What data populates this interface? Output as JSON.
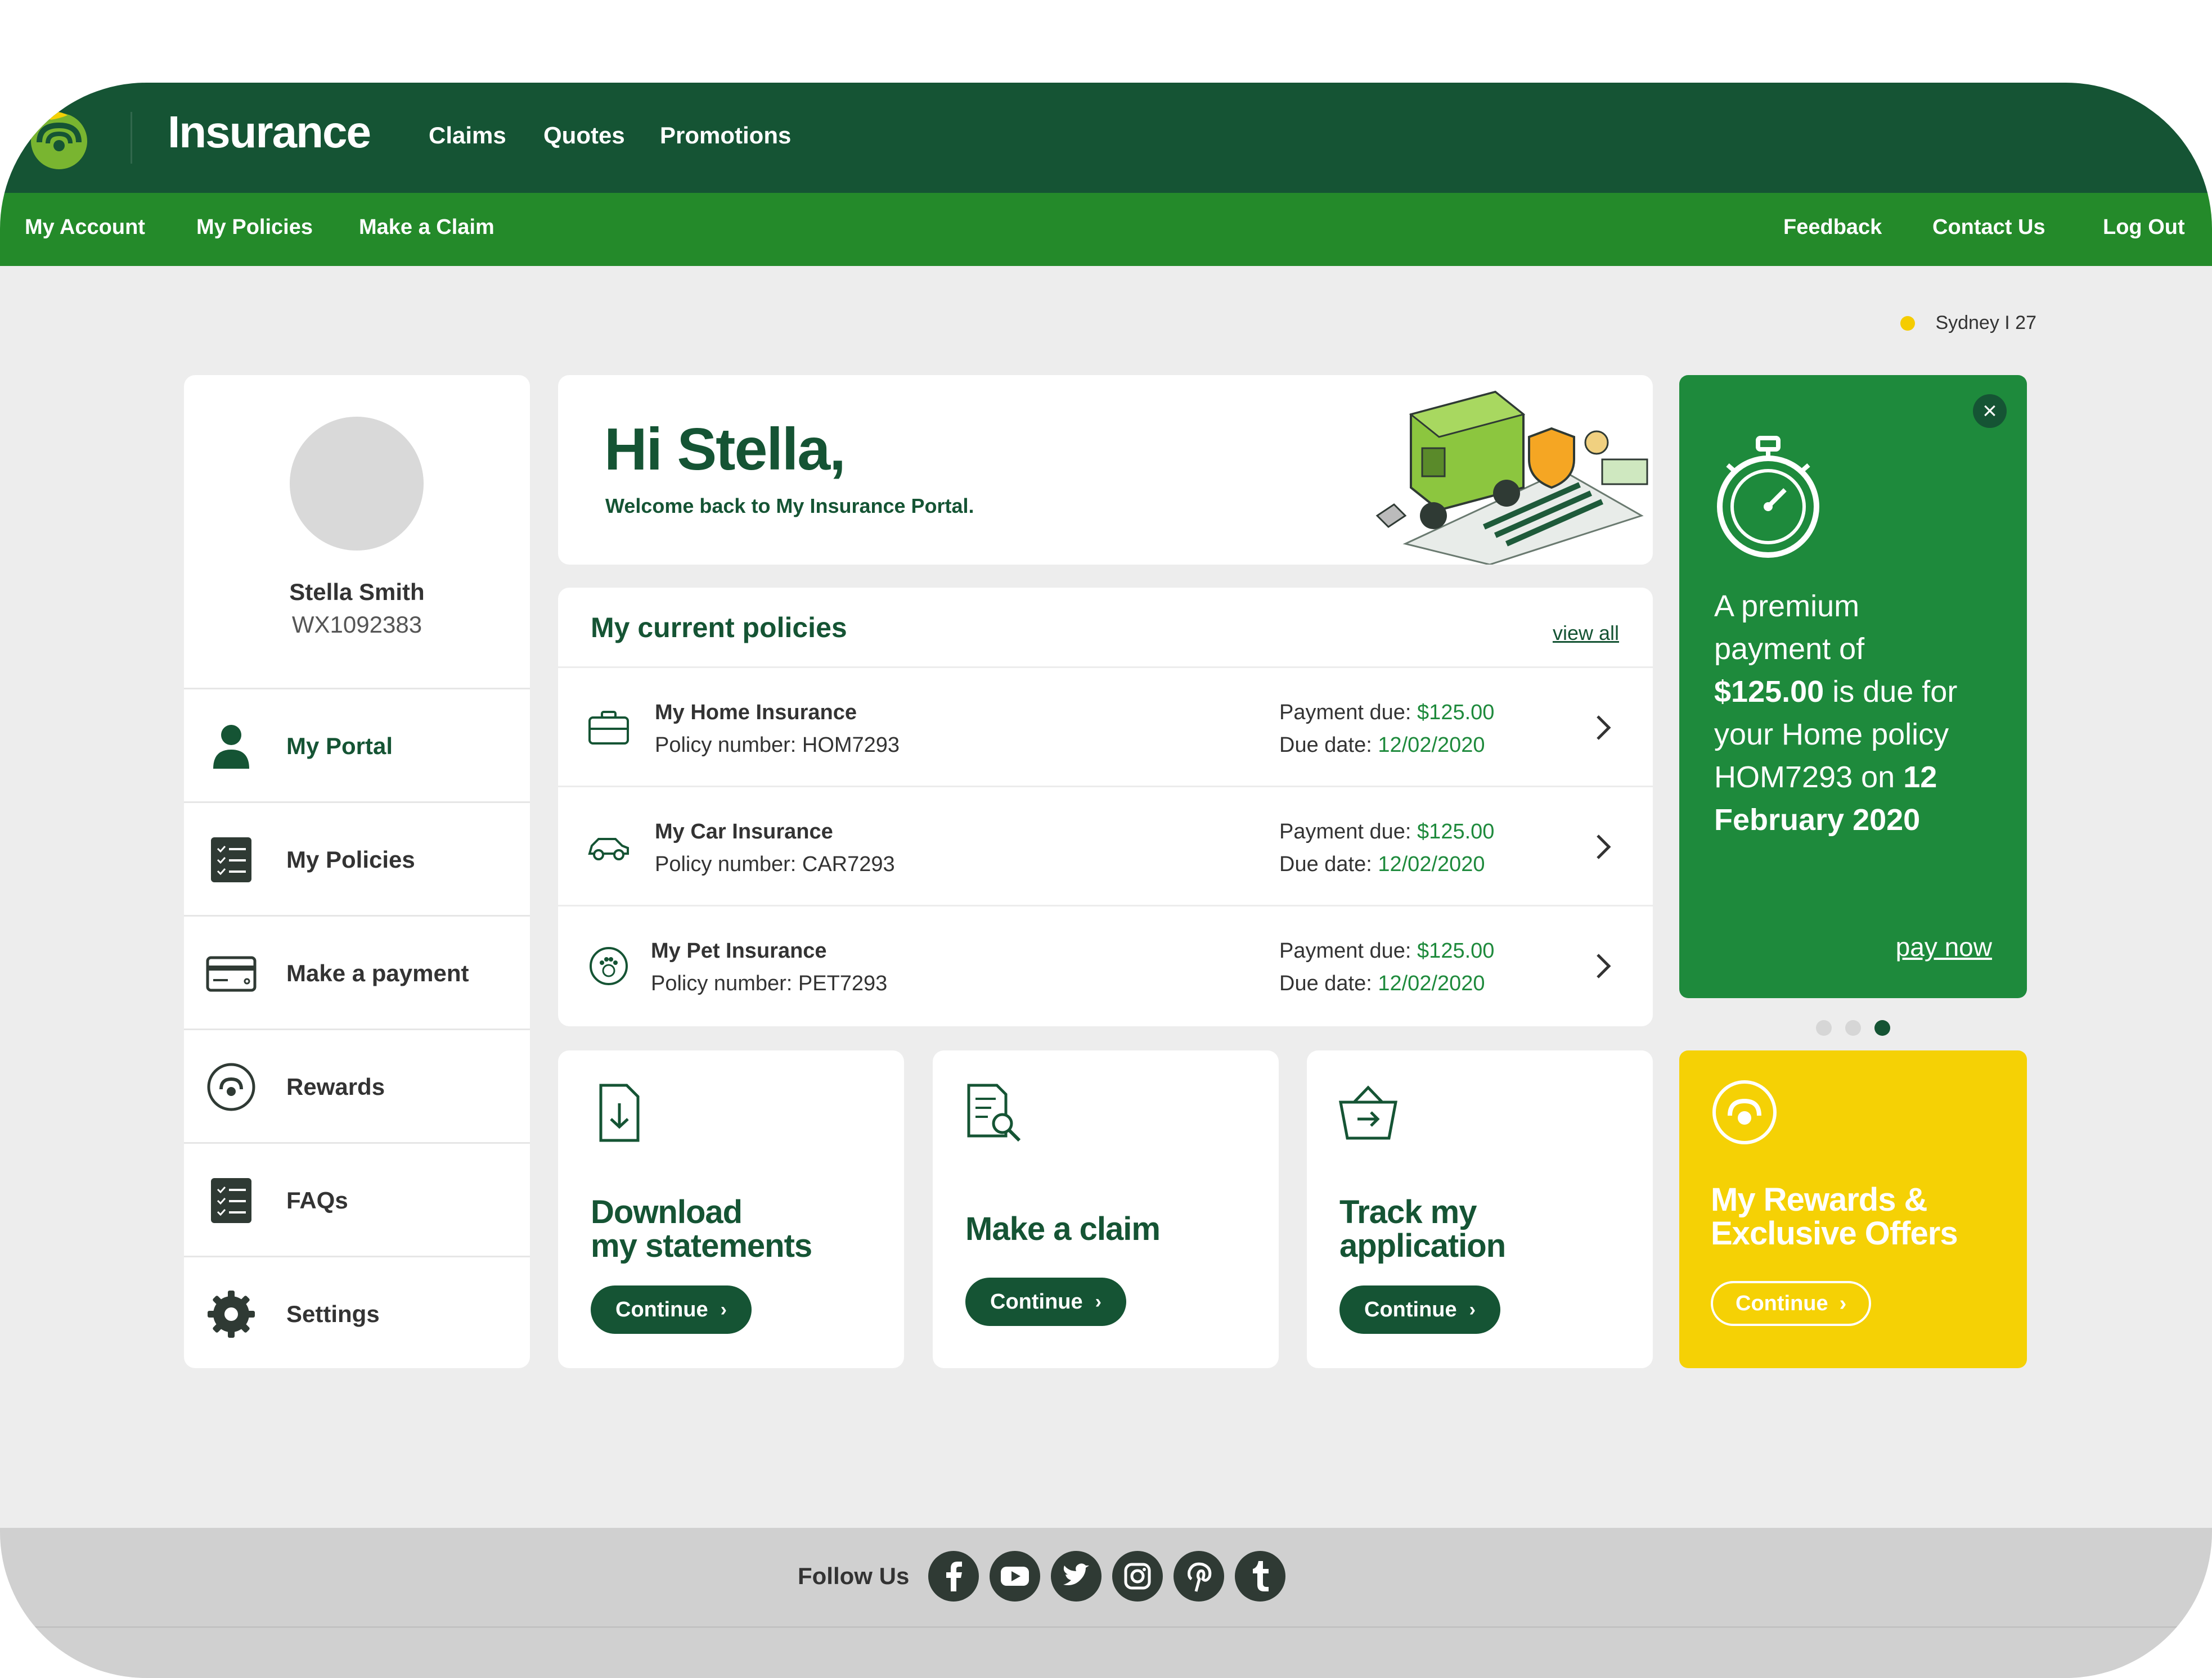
{
  "header": {
    "brand": "Insurance",
    "nav": [
      "Claims",
      "Quotes",
      "Promotions"
    ]
  },
  "subnav": {
    "left": [
      "My Account",
      "My Policies",
      "Make a Claim"
    ],
    "right": [
      "Feedback",
      "Contact Us",
      "Log Out"
    ]
  },
  "location": {
    "text": "Sydney I 27"
  },
  "profile": {
    "name": "Stella Smith",
    "id": "WX1092383"
  },
  "sidebar": {
    "items": [
      {
        "label": "My Portal",
        "icon": "person-icon",
        "active": true
      },
      {
        "label": "My Policies",
        "icon": "checklist-icon"
      },
      {
        "label": "Make a payment",
        "icon": "credit-card-icon"
      },
      {
        "label": "Rewards",
        "icon": "rewards-icon"
      },
      {
        "label": "FAQs",
        "icon": "checklist-icon"
      },
      {
        "label": "Settings",
        "icon": "gear-icon"
      }
    ]
  },
  "greeting": {
    "title": "Hi Stella,",
    "subtitle": "Welcome back to My Insurance Portal."
  },
  "policies": {
    "heading": "My current policies",
    "view_all": "view all",
    "payment_label": "Payment due:",
    "due_label": "Due date:",
    "items": [
      {
        "icon": "briefcase-icon",
        "name": "My Home Insurance",
        "number": "Policy number: HOM7293",
        "amount": "$125.00",
        "date": "12/02/2020"
      },
      {
        "icon": "car-icon",
        "name": "My Car Insurance",
        "number": "Policy number: CAR7293",
        "amount": "$125.00",
        "date": "12/02/2020"
      },
      {
        "icon": "paw-icon",
        "name": "My Pet Insurance",
        "number": "Policy number: PET7293",
        "amount": "$125.00",
        "date": "12/02/2020"
      }
    ]
  },
  "actions": [
    {
      "icon": "download-document-icon",
      "title1": "Download",
      "title2": "my statements",
      "button": "Continue"
    },
    {
      "icon": "search-document-icon",
      "title1": "Make a claim",
      "title2": "",
      "button": "Continue"
    },
    {
      "icon": "basket-icon",
      "title1": "Track my",
      "title2": "application",
      "button": "Continue"
    }
  ],
  "promo": {
    "line1": "A premium",
    "line2": "payment of",
    "amount": "$125.00",
    "line3": " is due for",
    "line4": "your Home policy",
    "line5": "HOM7293 on ",
    "date1": "12",
    "date2": "February 2020",
    "pay_now": "pay now",
    "carousel": {
      "count": 3,
      "active": 3
    }
  },
  "rewards": {
    "line1": "My Rewards &",
    "line2": "Exclusive Offers",
    "button": "Continue"
  },
  "footer": {
    "follow": "Follow Us",
    "social": [
      "facebook-icon",
      "youtube-icon",
      "twitter-icon",
      "instagram-icon",
      "pinterest-icon",
      "tumblr-icon"
    ]
  },
  "colors": {
    "header_dark_green": "#155434",
    "subnav_green": "#248a2a",
    "accent_green": "#1e8a3c",
    "rewards_yellow": "#f5d105",
    "background": "#ededed"
  }
}
